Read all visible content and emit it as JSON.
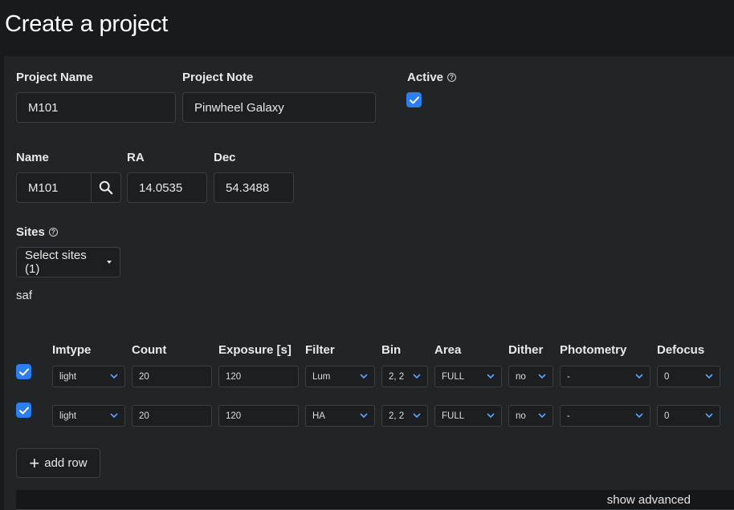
{
  "page": {
    "title": "Create a project"
  },
  "project": {
    "name_label": "Project Name",
    "name_value": "M101",
    "note_label": "Project Note",
    "note_value": "Pinwheel Galaxy",
    "active_label": "Active",
    "active_checked": true
  },
  "target": {
    "name_label": "Name",
    "name_value": "M101",
    "ra_label": "RA",
    "ra_value": "14.0535",
    "dec_label": "Dec",
    "dec_value": "54.3488"
  },
  "sites": {
    "label": "Sites",
    "select_label": "Select sites (1)",
    "selected": [
      "saf"
    ]
  },
  "table": {
    "headers": [
      "Imtype",
      "Count",
      "Exposure [s]",
      "Filter",
      "Bin",
      "Area",
      "Dither",
      "Photometry",
      "Defocus"
    ],
    "rows": [
      {
        "checked": true,
        "imtype": "light",
        "count": "20",
        "exposure": "120",
        "filter": "Lum",
        "bin": "2, 2",
        "area": "FULL",
        "dither": "no",
        "photometry": "-",
        "defocus": "0"
      },
      {
        "checked": true,
        "imtype": "light",
        "count": "20",
        "exposure": "120",
        "filter": "HA",
        "bin": "2, 2",
        "area": "FULL",
        "dither": "no",
        "photometry": "-",
        "defocus": "0"
      }
    ]
  },
  "actions": {
    "add_row_label": "add row",
    "show_advanced_label": "show advanced"
  },
  "icons": {
    "help": "help-circle-icon",
    "search": "search-icon",
    "check": "check-icon",
    "chevron": "chevron-down-icon",
    "plus": "plus-icon"
  },
  "colors": {
    "accent": "#2e7df2",
    "background": "#181a1b",
    "panel": "#222527"
  }
}
